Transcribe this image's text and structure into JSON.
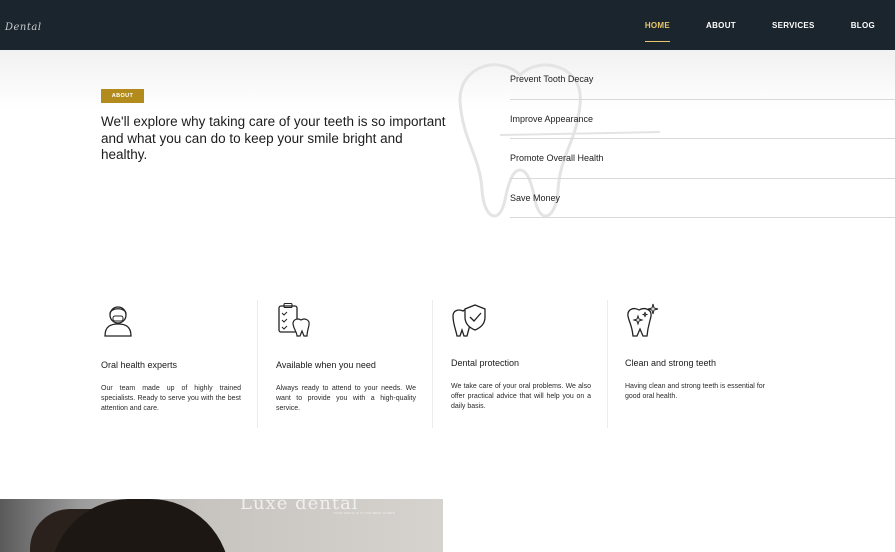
{
  "header": {
    "logo": "Dental",
    "nav": [
      {
        "label": "HOME",
        "active": true
      },
      {
        "label": "ABOUT",
        "active": false
      },
      {
        "label": "SERVICES",
        "active": false
      },
      {
        "label": "BLOG",
        "active": false
      }
    ]
  },
  "about": {
    "badge": "ABOUT",
    "text": "We'll explore why taking care of your teeth is so important and what you can do to keep your smile bright and healthy.",
    "benefits": [
      "Prevent Tooth Decay",
      "Improve Appearance",
      "Promote Overall Health",
      "Save Money"
    ]
  },
  "features": [
    {
      "icon": "dentist-icon",
      "title": "Oral health experts",
      "desc": "Our team made up of highly trained specialists. Ready to serve you with the best attention and care."
    },
    {
      "icon": "checklist-tooth-icon",
      "title": "Available when you need",
      "desc": "Always ready to attend to your needs. We want to provide you with a high-quality service."
    },
    {
      "icon": "shield-tooth-icon",
      "title": "Dental protection",
      "desc": "We take care of your oral problems. We also offer practical advice that will help you on a daily basis."
    },
    {
      "icon": "sparkle-tooth-icon",
      "title": "Clean and strong teeth",
      "desc": "Having clean and strong teeth is essential for good oral health."
    }
  ],
  "photo": {
    "brand": "Luxe dental",
    "brand_sub": "YOUR SMILE IS IN THE BEST HANDS"
  },
  "colors": {
    "nav_bg": "#1b252d",
    "accent": "#e8c76a",
    "badge": "#b38b1d"
  }
}
